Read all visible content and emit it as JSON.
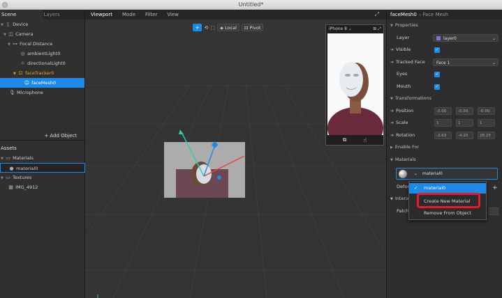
{
  "window": {
    "title": "Untitled*"
  },
  "left_panel": {
    "tabs": [
      "Scene",
      "Layers"
    ],
    "scene_tree": [
      {
        "label": "Device",
        "icon": "device-icon"
      },
      {
        "label": "Camera",
        "icon": "camera-icon"
      },
      {
        "label": "Focal Distance",
        "icon": "focal-distance-icon"
      },
      {
        "label": "ambientLight0",
        "icon": "ambient-light-icon"
      },
      {
        "label": "directionalLight0",
        "icon": "directional-light-icon"
      },
      {
        "label": "faceTracker0",
        "icon": "face-tracker-icon"
      },
      {
        "label": "faceMesh0",
        "icon": "face-mesh-icon"
      },
      {
        "label": "Microphone",
        "icon": "microphone-icon"
      }
    ],
    "add_object": "+ Add Object",
    "assets_header": "Assets",
    "assets_tree": [
      {
        "label": "Materials",
        "icon": "folder-icon"
      },
      {
        "label": "material0",
        "icon": "material-ball-icon"
      },
      {
        "label": "Textures",
        "icon": "folder-icon"
      },
      {
        "label": "IMG_4912",
        "icon": "image-icon"
      }
    ]
  },
  "viewport": {
    "menu": [
      "Viewport",
      "Mode",
      "Filter",
      "View"
    ],
    "toolbar": {
      "local": "Local",
      "pivot": "Pivot"
    },
    "preview_device": "iPhone 8"
  },
  "inspector": {
    "title": "faceMesh0",
    "subtitle": "– Face Mesh",
    "properties_header": "Properties",
    "layer_label": "Layer",
    "layer_value": "layer0",
    "visible_label": "Visible",
    "tracked_face_label": "Tracked Face",
    "tracked_face_value": "Face 1",
    "eyes_label": "Eyes",
    "mouth_label": "Mouth",
    "transformations_header": "Transformations",
    "position_label": "Position",
    "position_values": [
      "-0.00",
      "-0.00",
      "-0.00"
    ],
    "scale_label": "Scale",
    "scale_values": [
      "1",
      "1",
      "1"
    ],
    "rotation_label": "Rotation",
    "rotation_values": [
      "-2.63",
      "-4.20",
      "28.23"
    ],
    "enable_for_label": "Enable For",
    "materials_header": "Materials",
    "material_value": "material0",
    "deformation_label": "Deform",
    "interactions_label": "Interac",
    "patch_label": "Patch"
  },
  "context_menu": {
    "items": [
      "material0",
      "Create New Material",
      "Remove From Object"
    ]
  },
  "colors": {
    "accent": "#1e8ae8",
    "highlight": "#e8192c"
  }
}
